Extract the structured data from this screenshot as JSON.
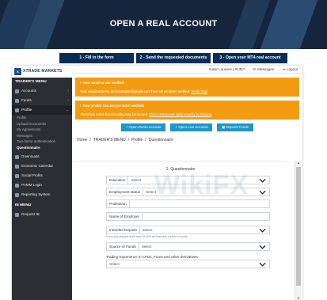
{
  "hero": {
    "title": "OPEN A REAL ACCOUNT"
  },
  "steps": [
    "1 - Fill in the form",
    "2 - Send the requested documents",
    "3 - Open your MT4 real account"
  ],
  "logo": {
    "text": "XTRADE MARKETS"
  },
  "sidebar": {
    "header": "TRADER'S MENU",
    "items": [
      {
        "label": "Accounts",
        "icon": "accounts-icon",
        "chevron": "‹"
      },
      {
        "label": "Funds",
        "icon": "funds-icon",
        "chevron": "‹"
      },
      {
        "label": "Profile",
        "icon": "profile-icon",
        "chevron": "⌄"
      }
    ],
    "profile_sub": [
      "Profile",
      "Upload Documents",
      "My Agreements",
      "Messages",
      "Two-factor authentication",
      "Questionnaire"
    ],
    "items2": [
      {
        "label": "Downloads",
        "icon": "downloads-icon"
      },
      {
        "label": "Economic Calendar",
        "icon": "calendar-icon"
      },
      {
        "label": "Social Profits",
        "icon": "social-icon"
      },
      {
        "label": "PAMM Login",
        "icon": "pamm-icon"
      },
      {
        "label": "Reporting System",
        "icon": "reporting-icon"
      }
    ],
    "header2": "IB MENU",
    "ib_item": {
      "label": "Request IB",
      "icon": "request-ib-icon"
    }
  },
  "topbar": {
    "user": "Nasir Lourens | 91357",
    "messages": "Messages",
    "logout": "Logout"
  },
  "alerts": {
    "email_title": "Your email is not verified",
    "email_body": "Your email address loronsnaglais@gmail.com has not yet been verified.",
    "email_link": "Verify now",
    "profile_title": "Your profile has not yet been verified",
    "profile_body": "Therefore some functionality may be limited.",
    "profile_link": "Click here to see what exactly is missing"
  },
  "buttons": {
    "demo": "+ Open Demo Account",
    "live": "+ Open Live Account",
    "deposit": "Deposit Funds"
  },
  "breadcrumb": [
    "Home",
    "TRADER'S MENU",
    "Profile",
    "Questionnaire"
  ],
  "questionnaire": {
    "title": "1. Questionnaire",
    "education": {
      "label": "Education",
      "value": "Select"
    },
    "employment": {
      "label": "Employment status",
      "value": "Select"
    },
    "profession": {
      "label": "Profession"
    },
    "employer": {
      "label": "Name of Employer"
    },
    "deposit": {
      "label": "Intended Deposit",
      "value": "Select",
      "hint": "If you are deposit more than 50,000 we may ask a proof of funds."
    },
    "funds": {
      "label": "Source of Funds",
      "value": "Select"
    },
    "experience": {
      "label": "Trading Experience in CFDs, Forex and other derivatives",
      "value": "Select"
    }
  },
  "watermark": "WikiFX"
}
